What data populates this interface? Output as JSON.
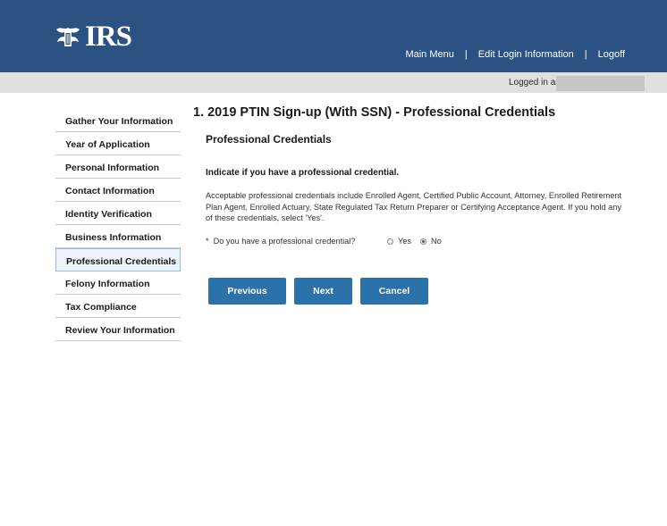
{
  "header": {
    "logo_text": "IRS",
    "logo_icon": "irs-eagle-icon",
    "nav": [
      "Main Menu",
      "Edit Login Information",
      "Logoff"
    ],
    "separator": "|",
    "background": "#2b5283"
  },
  "login": {
    "label": "Logged in as"
  },
  "sidebar": {
    "items": [
      {
        "label": "Gather Your Information"
      },
      {
        "label": "Year of Application"
      },
      {
        "label": "Personal Information"
      },
      {
        "label": "Contact Information"
      },
      {
        "label": "Identity Verification"
      },
      {
        "label": "Business Information"
      },
      {
        "label": "Professional Credentials",
        "active": true
      },
      {
        "label": "Felony Information"
      },
      {
        "label": "Tax Compliance"
      },
      {
        "label": "Review Your Information"
      }
    ]
  },
  "main": {
    "title": "1. 2019 PTIN Sign-up (With SSN) - Professional Credentials",
    "section_title": "Professional Credentials",
    "instruction": "Indicate if you have a professional credential.",
    "help_text": "Acceptable professional credentials include Enrolled Agent, Certified Public Account, Attorney, Enrolled Retirement Plan Agent, Enrolled Actuary, State Regulated Tax Return Preparer or Certifying Acceptance Agent. If you hold any of these credentials, select 'Yes'.",
    "question": {
      "required_marker": "*",
      "label": "Do you have a professional credential?",
      "options": [
        "Yes",
        "No"
      ],
      "selected": "No"
    },
    "buttons": {
      "previous": "Previous",
      "next": "Next",
      "cancel": "Cancel"
    }
  },
  "colors": {
    "accent": "#2b72aa",
    "header": "#2b5283",
    "login_bar": "#e0e0e0"
  }
}
